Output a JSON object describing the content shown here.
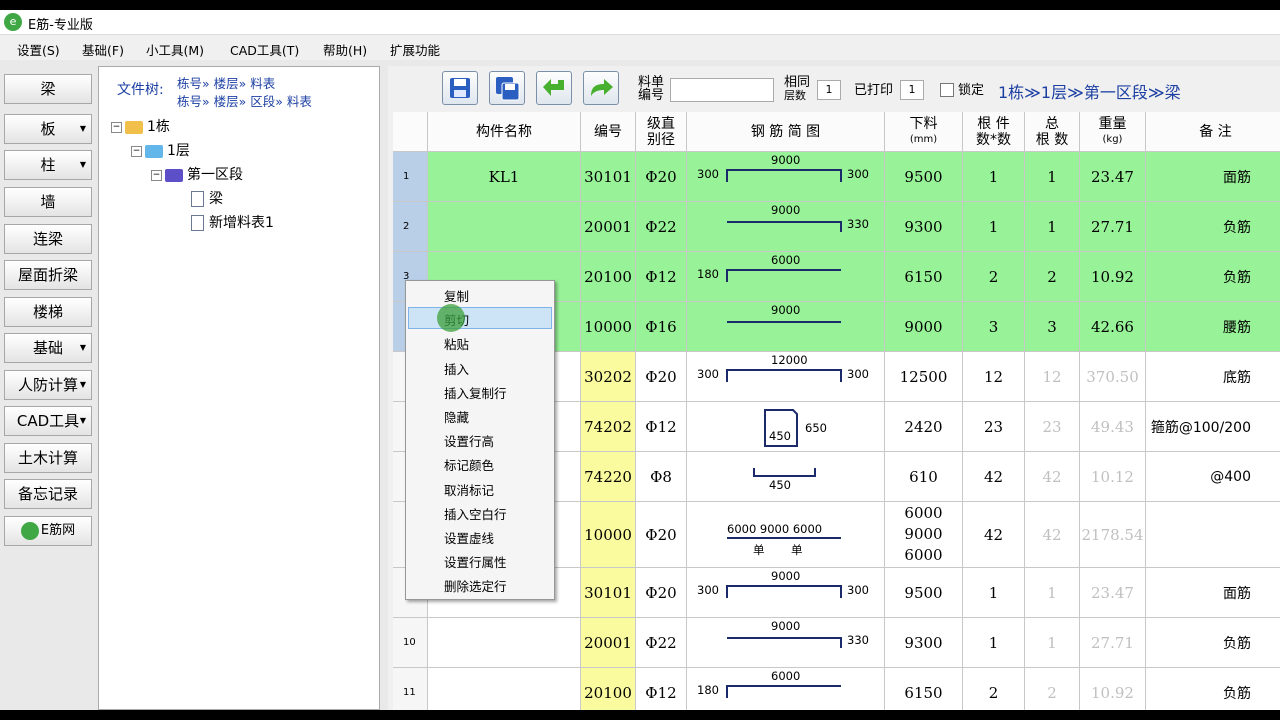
{
  "window": {
    "title": "E筋-专业版"
  },
  "menu": [
    "设置(S)",
    "基础(F)",
    "小工具(M)",
    "CAD工具(T)",
    "帮助(H)",
    "扩展功能"
  ],
  "leftbar": [
    {
      "label": "梁",
      "dropdown": false
    },
    {
      "label": "板",
      "dropdown": true
    },
    {
      "label": "柱",
      "dropdown": true
    },
    {
      "label": "墙",
      "dropdown": false
    },
    {
      "label": "连梁",
      "dropdown": false
    },
    {
      "label": "屋面折梁",
      "dropdown": false
    },
    {
      "label": "楼梯",
      "dropdown": false
    },
    {
      "label": "基础",
      "dropdown": true
    },
    {
      "label": "人防计算",
      "dropdown": true
    },
    {
      "label": "CAD工具",
      "dropdown": true
    },
    {
      "label": "土木计算",
      "dropdown": false
    },
    {
      "label": "备忘记录",
      "dropdown": false
    },
    {
      "label": "E筋网",
      "dropdown": false
    }
  ],
  "tree": {
    "label": "文件树:",
    "path1": "栋号» 楼层» 料表",
    "path2": "栋号» 楼层» 区段» 料表",
    "nodes": [
      "1栋",
      "1层",
      "第一区段",
      "梁",
      "新增料表1"
    ]
  },
  "toolbar": {
    "sheet_no_label_1": "料单",
    "sheet_no_label_2": "编号",
    "sheet_no_value": "",
    "same_floors_label_1": "相同",
    "same_floors_label_2": "层数",
    "same_floors_value": "1",
    "printed_label": "已打印",
    "printed_value": "1",
    "lock_label": "锁定",
    "lock_checked": false,
    "breadcrumb": "1栋≫1层≫第一区段≫梁"
  },
  "columns": {
    "name": "构件名称",
    "code": "编号",
    "grade_1": "级直",
    "grade_2": "别径",
    "sketch": "钢 筋 简 图",
    "cut_1": "下料",
    "cut_2": "(mm)",
    "count_1": "根 件",
    "count_2": "数*数",
    "total_1": "总",
    "total_2": "根 数",
    "weight_1": "重量",
    "weight_2": "(kg)",
    "note": "备      注"
  },
  "rows": [
    {
      "n": "1",
      "name": "KL1",
      "code": "30101",
      "grade": "Φ20",
      "cut": "9500",
      "count": "1",
      "total": "1",
      "weight": "23.47",
      "note": "面筋",
      "sketch": {
        "top": "9000",
        "left": "300",
        "right": "300"
      }
    },
    {
      "n": "2",
      "name": "",
      "code": "20001",
      "grade": "Φ22",
      "cut": "9300",
      "count": "1",
      "total": "1",
      "weight": "27.71",
      "note": "负筋",
      "sketch": {
        "top": "9000",
        "left": "",
        "right": "330"
      }
    },
    {
      "n": "3",
      "name": "",
      "code": "20100",
      "grade": "Φ12",
      "cut": "6150",
      "count": "2",
      "total": "2",
      "weight": "10.92",
      "note": "负筋",
      "sketch": {
        "top": "6000",
        "left": "180",
        "right": ""
      }
    },
    {
      "n": "",
      "name": "",
      "code": "10000",
      "grade": "Φ16",
      "cut": "9000",
      "count": "3",
      "total": "3",
      "weight": "42.66",
      "note": "腰筋",
      "sketch": {
        "top": "9000",
        "left": "",
        "right": ""
      }
    },
    {
      "n": "",
      "name": "",
      "code": "30202",
      "grade": "Φ20",
      "cut": "12500",
      "count": "12",
      "total": "12",
      "weight": "370.50",
      "note": "底筋",
      "sketch": {
        "top": "12000",
        "left": "300",
        "right": "300"
      }
    },
    {
      "n": "",
      "name": "",
      "code": "74202",
      "grade": "Φ12",
      "cut": "2420",
      "count": "23",
      "total": "23",
      "weight": "49.43",
      "note": "箍筋@100/200",
      "sketch": {
        "top": "450",
        "left": "",
        "right": "650"
      }
    },
    {
      "n": "",
      "name": "",
      "code": "74220",
      "grade": "Φ8",
      "cut": "610",
      "count": "42",
      "total": "42",
      "weight": "10.12",
      "note": "@400",
      "sketch": {
        "top": "450",
        "left": "",
        "right": ""
      }
    },
    {
      "n": "",
      "name": "",
      "code": "10000",
      "grade": "Φ20",
      "cut": "6000\n9000\n6000",
      "count": "42",
      "total": "42",
      "weight": "2178.54",
      "note": "",
      "sketch": {
        "top": "6000_9000_6000",
        "left": "单",
        "right": "单"
      }
    },
    {
      "n": "",
      "name": "",
      "code": "30101",
      "grade": "Φ20",
      "cut": "9500",
      "count": "1",
      "total": "1",
      "weight": "23.47",
      "note": "面筋",
      "sketch": {
        "top": "9000",
        "left": "300",
        "right": "300"
      }
    },
    {
      "n": "10",
      "name": "",
      "code": "20001",
      "grade": "Φ22",
      "cut": "9300",
      "count": "1",
      "total": "1",
      "weight": "27.71",
      "note": "负筋",
      "sketch": {
        "top": "9000",
        "left": "",
        "right": "330"
      }
    },
    {
      "n": "11",
      "name": "",
      "code": "20100",
      "grade": "Φ12",
      "cut": "6150",
      "count": "2",
      "total": "2",
      "weight": "10.92",
      "note": "负筋",
      "sketch": {
        "top": "6000",
        "left": "180",
        "right": ""
      }
    }
  ],
  "context_menu": {
    "items": [
      "复制",
      "剪切",
      "粘贴",
      "插入",
      "插入复制行",
      "隐藏",
      "设置行高",
      "标记颜色",
      "取消标记",
      "插入空白行",
      "设置虚线",
      "设置行属性",
      "删除选定行"
    ],
    "highlighted": "剪切"
  },
  "colors": {
    "selected_row": "#98f298",
    "code_cell": "#fafa9e",
    "accent": "#1c3fa3"
  }
}
